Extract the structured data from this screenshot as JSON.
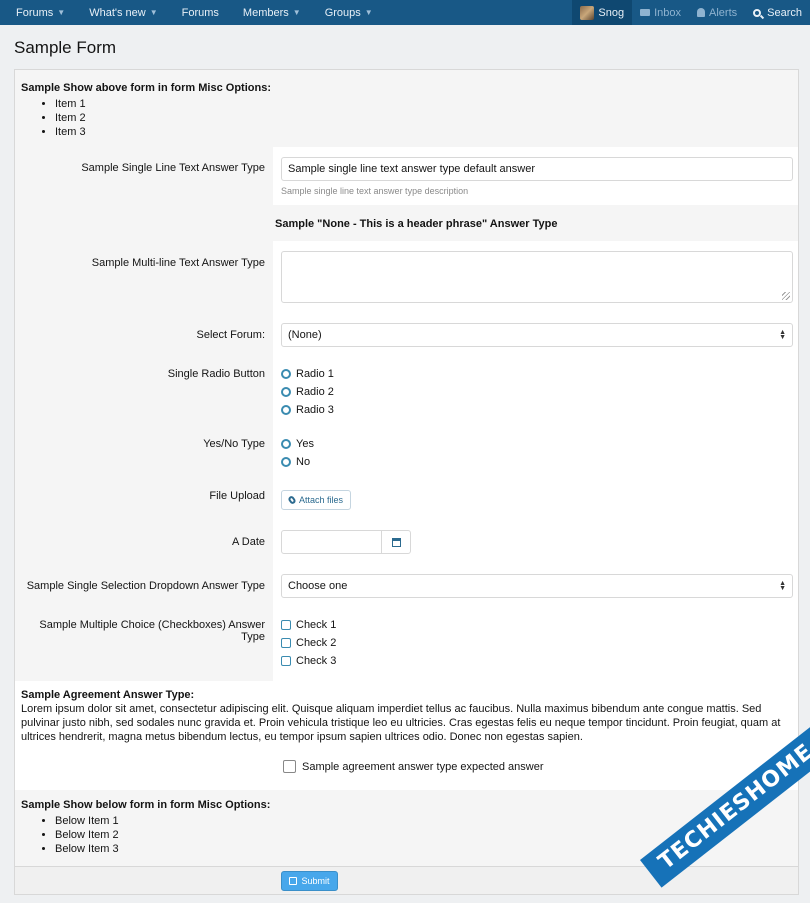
{
  "nav": {
    "items": [
      {
        "label": "Forums",
        "dropdown": true
      },
      {
        "label": "What's new",
        "dropdown": true
      },
      {
        "label": "Forums",
        "dropdown": false
      },
      {
        "label": "Members",
        "dropdown": true
      },
      {
        "label": "Groups",
        "dropdown": true
      }
    ],
    "user": "Snog",
    "inbox": "Inbox",
    "alerts": "Alerts",
    "search": "Search"
  },
  "page_title": "Sample Form",
  "pre": {
    "title": "Sample Show above form in form Misc Options:",
    "items": [
      "Item 1",
      "Item 2",
      "Item 3"
    ]
  },
  "fields": {
    "single_line": {
      "label": "Sample Single Line Text Answer Type",
      "value": "Sample single line text answer type default answer",
      "hint": "Sample single line text answer type description"
    },
    "header_phrase": "Sample \"None - This is a header phrase\" Answer Type",
    "multi_line": {
      "label": "Sample Multi-line Text Answer Type",
      "value": ""
    },
    "select_forum": {
      "label": "Select Forum:",
      "value": "(None)"
    },
    "single_radio": {
      "label": "Single Radio Button",
      "options": [
        "Radio 1",
        "Radio 2",
        "Radio 3"
      ]
    },
    "yes_no": {
      "label": "Yes/No Type",
      "options": [
        "Yes",
        "No"
      ]
    },
    "file_upload": {
      "label": "File Upload",
      "button": "Attach files"
    },
    "date": {
      "label": "A Date",
      "value": ""
    },
    "single_dropdown": {
      "label": "Sample Single Selection Dropdown Answer Type",
      "value": "Choose one"
    },
    "checkboxes": {
      "label": "Sample Multiple Choice (Checkboxes) Answer Type",
      "options": [
        "Check 1",
        "Check 2",
        "Check 3"
      ]
    }
  },
  "agreement": {
    "title": "Sample Agreement Answer Type:",
    "text": "Lorem ipsum dolor sit amet, consectetur adipiscing elit. Quisque aliquam imperdiet tellus ac faucibus. Nulla maximus bibendum ante congue mattis. Sed pulvinar justo nibh, sed sodales nunc gravida et. Proin vehicula tristique leo eu ultricies. Cras egestas felis eu neque tempor tincidunt. Proin feugiat, quam at ultrices hendrerit, magna metus bibendum lectus, eu tempor ipsum sapien ultrices odio. Donec non egestas sapien.",
    "check_label": "Sample agreement answer type expected answer"
  },
  "post": {
    "title": "Sample Show below form in form Misc Options:",
    "items": [
      "Below Item 1",
      "Below Item 2",
      "Below Item 3"
    ]
  },
  "submit": "Submit",
  "watermark": "TECHIESHOME.COM"
}
